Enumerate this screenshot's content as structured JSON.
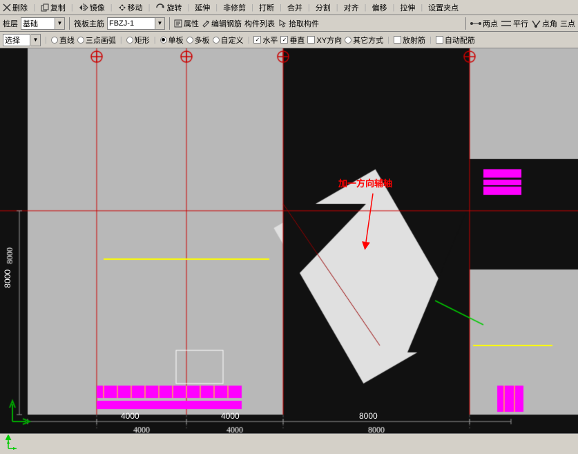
{
  "toolbar1": {
    "items": [
      "删除",
      "复制",
      "镜像",
      "移动",
      "旋转",
      "延伸",
      "非修剪",
      "打断",
      "合并",
      "分割",
      "对齐",
      "偏移",
      "拉伸",
      "设置夹点"
    ]
  },
  "toolbar2": {
    "layer_label": "桩层",
    "layer_value": "基础",
    "element_label": "筏板主筋",
    "element_value": "FBZJ-1",
    "buttons": [
      "属性",
      "编辑钢筋",
      "构件列表",
      "拾取构件"
    ],
    "right_buttons": [
      "两点",
      "平行",
      "点角",
      "三点"
    ]
  },
  "toolbar3": {
    "items": [
      "选择",
      "直线",
      "三点画弧",
      "矩形",
      "单板",
      "多板",
      "自定义",
      "水平",
      "垂直",
      "XY方向",
      "其它方式",
      "放射筋",
      "自动配筋"
    ]
  },
  "canvas": {
    "annotation": "加一方向辅轴",
    "dimensions": {
      "bottom_left": "4000",
      "bottom_middle": "4000",
      "bottom_right": "8000",
      "left_side": "8000"
    }
  },
  "statusbar": {
    "coords": ""
  }
}
